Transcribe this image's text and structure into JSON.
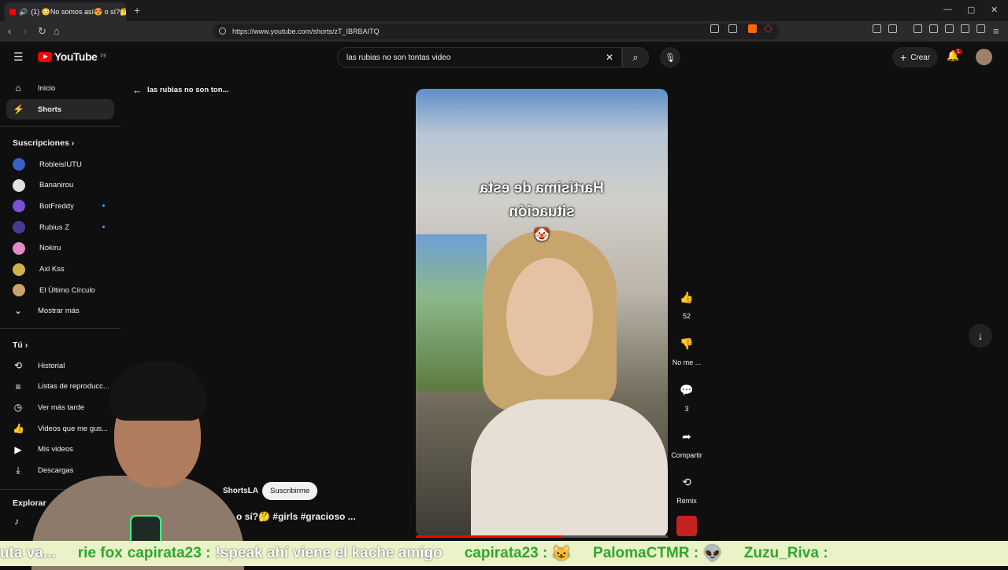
{
  "browser": {
    "tab_title": "(1) 😳No somos así😍 o sí?🤔",
    "url": "https://www.youtube.com/shorts/zT_IBRBAITQ"
  },
  "header": {
    "logo_text": "YouTube",
    "region": "PE",
    "search_value": "las rubias no son tontas video",
    "create_label": "Crear",
    "notification_count": "1"
  },
  "sidebar": {
    "main": [
      {
        "label": "Inicio",
        "icon": "home-icon"
      },
      {
        "label": "Shorts",
        "icon": "shorts-icon",
        "selected": true
      }
    ],
    "subscriptions_heading": "Suscripciones",
    "subscriptions": [
      {
        "label": "RobleisIUTU",
        "color": "#3a5fc7"
      },
      {
        "label": "Bananirou",
        "color": "#e0e0e0"
      },
      {
        "label": "BotFreddy",
        "color": "#7b4fd6"
      },
      {
        "label": "Rubius Z",
        "color": "#4a3b8f"
      },
      {
        "label": "Nokiru",
        "color": "#e28ac9"
      },
      {
        "label": "Axl Kss",
        "color": "#d1b24a"
      },
      {
        "label": "El Último Círculo",
        "color": "#c8a46a"
      }
    ],
    "show_more": "Mostrar más",
    "you_heading": "Tú",
    "you_items": [
      {
        "label": "Historial",
        "icon": "history-icon"
      },
      {
        "label": "Listas de reproducc...",
        "icon": "playlist-icon"
      },
      {
        "label": "Ver más tarde",
        "icon": "clock-icon"
      },
      {
        "label": "Videos que me gus...",
        "icon": "thumbs-up-icon"
      },
      {
        "label": "Mis videos",
        "icon": "video-icon"
      },
      {
        "label": "Descargas",
        "icon": "download-icon"
      }
    ],
    "explore_heading": "Explorar"
  },
  "short": {
    "back_label": "las rubias no son ton...",
    "caption_line1": "Hartísima de esta",
    "caption_line2": "situación",
    "progress": 0.58,
    "channel": "ShortsLA",
    "subscribe_label": "Suscribirme",
    "title": "o sí?🤔 #girls #gracioso ..."
  },
  "actions": {
    "likes": "52",
    "dislike_label": "No me ...",
    "comments": "3",
    "share_label": "Compartir",
    "remix_label": "Remix"
  },
  "chat_ticker": [
    {
      "user": "",
      "msg": "uta va..."
    },
    {
      "user": "rie fox",
      "msg": ""
    },
    {
      "user": "capirata23 :",
      "msg": "!speak ahí viene el kache amigo"
    },
    {
      "user": "capirata23 :",
      "msg": "😺"
    },
    {
      "user": "PalomaCTMR :",
      "msg": "👽"
    },
    {
      "user": "Zuzu_Riva :",
      "msg": ""
    }
  ]
}
